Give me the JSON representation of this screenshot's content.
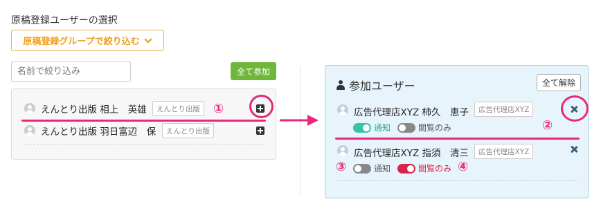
{
  "left": {
    "section_title": "原稿登録ユーザーの選択",
    "filter_button_label": "原稿登録グループで絞り込む",
    "search_placeholder": "名前で絞り込み",
    "add_all_label": "全て参加",
    "users": [
      {
        "name": "えんとり出版 相上　英雄",
        "org": "えんとり出版"
      },
      {
        "name": "えんとり出版 羽日富辺　保",
        "org": "えんとり出版"
      }
    ]
  },
  "right": {
    "title": "参加ユーザー",
    "clear_all_label": "全て解除",
    "users": [
      {
        "name": "広告代理店XYZ 柿久　恵子",
        "org": "広告代理店XYZ",
        "notify_label": "通知",
        "notify_on": true,
        "view_label": "閲覧のみ",
        "view_on": false
      },
      {
        "name": "広告代理店XYZ 指須　清三",
        "org": "広告代理店XYZ",
        "notify_label": "通知",
        "notify_on": false,
        "view_label": "閲覧のみ",
        "view_on": true
      }
    ]
  },
  "annotations": {
    "n1": "①",
    "n2": "②",
    "n3": "③",
    "n4": "④",
    "color": "#e8287a"
  },
  "icons": [
    "chevron-down-icon",
    "avatar-icon",
    "plus-square-icon",
    "person-icon",
    "close-icon",
    "arrow-right-icon"
  ]
}
